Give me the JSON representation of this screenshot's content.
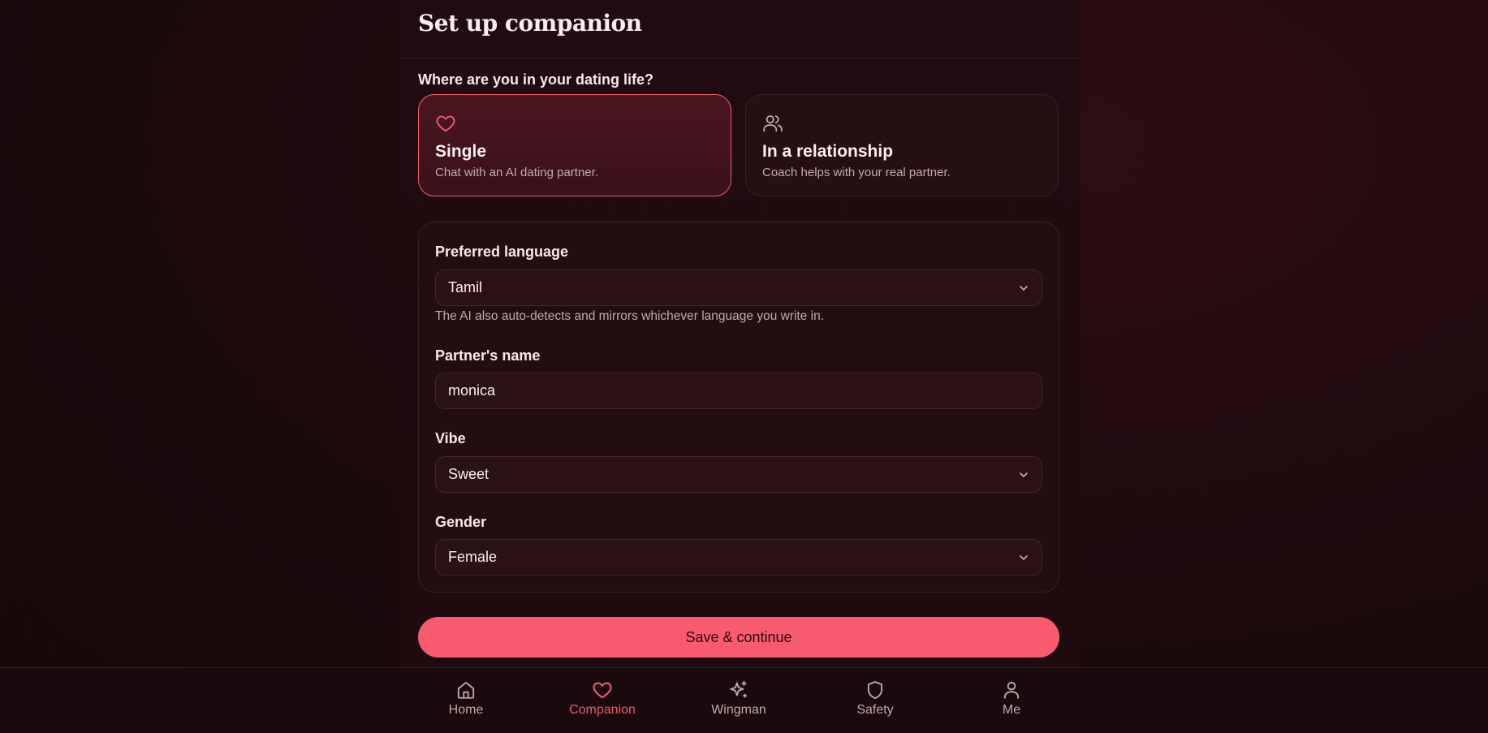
{
  "header": {
    "title": "Set up companion"
  },
  "question": "Where are you in your dating life?",
  "choices": [
    {
      "title": "Single",
      "subtitle": "Chat with an AI dating partner.",
      "icon": "heart-icon",
      "selected": true
    },
    {
      "title": "In a relationship",
      "subtitle": "Coach helps with your real partner.",
      "icon": "users-icon",
      "selected": false
    }
  ],
  "form": {
    "language": {
      "label": "Preferred language",
      "value": "Tamil",
      "hint": "The AI also auto-detects and mirrors whichever language you write in."
    },
    "partner_name": {
      "label": "Partner's name",
      "value": "monica"
    },
    "vibe": {
      "label": "Vibe",
      "value": "Sweet"
    },
    "gender": {
      "label": "Gender",
      "value": "Female"
    }
  },
  "save_label": "Save & continue",
  "nav": {
    "items": [
      {
        "label": "Home",
        "icon": "home-icon"
      },
      {
        "label": "Companion",
        "icon": "heart-icon",
        "active": true
      },
      {
        "label": "Wingman",
        "icon": "sparkles-icon"
      },
      {
        "label": "Safety",
        "icon": "shield-icon"
      },
      {
        "label": "Me",
        "icon": "user-icon"
      }
    ]
  },
  "colors": {
    "accent": "#f85b6f",
    "background": "#1c0a0d",
    "card": "#220d11"
  }
}
